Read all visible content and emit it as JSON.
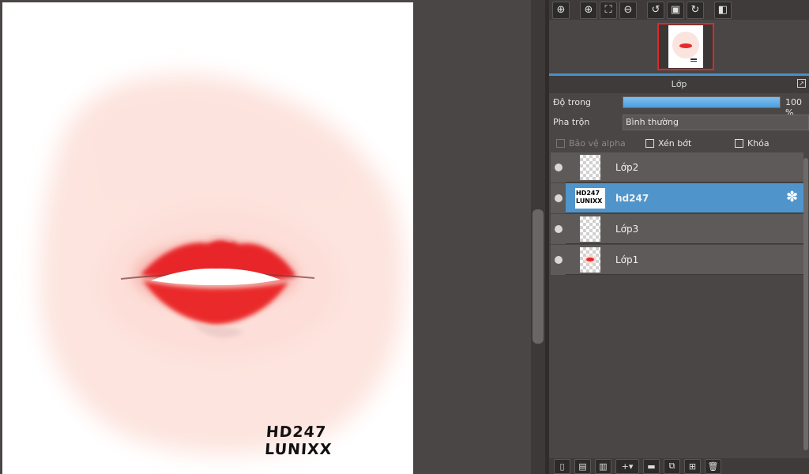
{
  "canvas": {
    "watermark_line1": "HD247",
    "watermark_line2": "LUNIXX"
  },
  "nav_toolbar": {
    "icons": [
      "zoom-fit-icon",
      "zoom-in-icon",
      "fit-screen-icon",
      "zoom-out-icon",
      "rotate-left-icon",
      "actual-size-icon",
      "rotate-right-icon",
      "flip-icon"
    ]
  },
  "layer_panel": {
    "title": "Lớp",
    "opacity_label": "Độ trong",
    "opacity_value": "100 %",
    "opacity_fraction": 1.0,
    "blend_label": "Pha trộn",
    "blend_value": "Bình thường",
    "protect_alpha_label": "Bảo vệ alpha",
    "clip_label": "Xén bớt",
    "lock_label": "Khóa",
    "layers": [
      {
        "name": "Lớp2",
        "thumb": "transparent",
        "selected": false
      },
      {
        "name": "hd247",
        "thumb": "text",
        "thumb_text": "HD247 LUNIXX",
        "selected": true
      },
      {
        "name": "Lớp3",
        "thumb": "transparent",
        "selected": false
      },
      {
        "name": "Lớp1",
        "thumb": "lips",
        "selected": false
      }
    ]
  },
  "colors": {
    "selected_layer": "#4f95cc",
    "lip_red": "#e42a2a",
    "skin_pink": "#fbe3de",
    "nav_frame": "#e02828"
  }
}
